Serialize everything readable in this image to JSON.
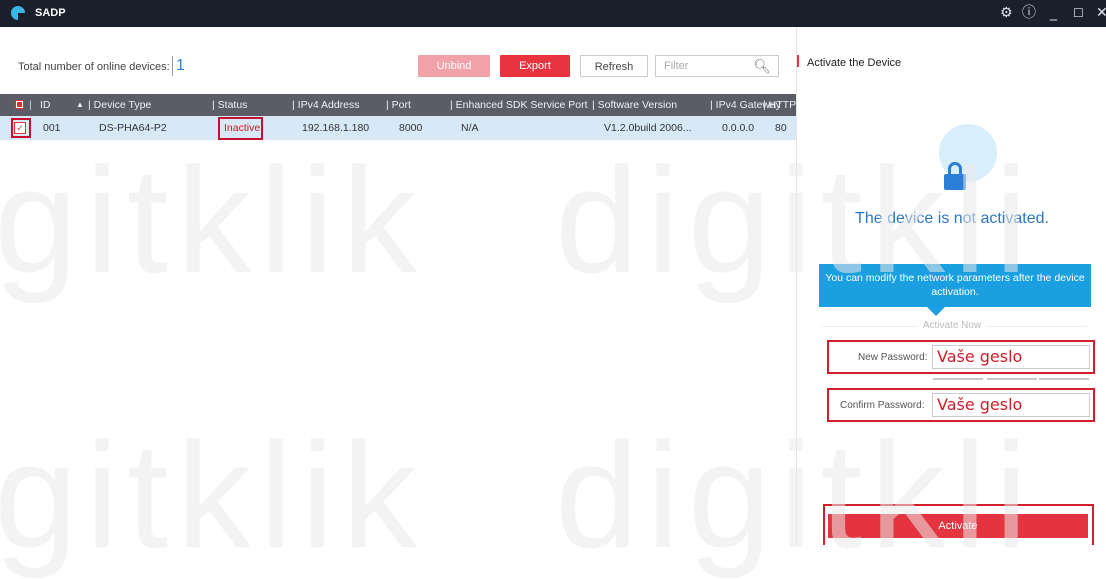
{
  "titlebar": {
    "app_name": "SADP",
    "icons": [
      "gear-icon",
      "info-icon",
      "minimize-icon",
      "maximize-icon",
      "close-icon"
    ]
  },
  "device_list": {
    "total_label": "Total number of online devices:",
    "total_count": "1",
    "buttons": {
      "unbind": "Unbind",
      "export": "Export",
      "refresh": "Refresh"
    },
    "filter_placeholder": "Filter",
    "columns": [
      "ID",
      "Device Type",
      "Status",
      "IPv4 Address",
      "Port",
      "Enhanced SDK Service Port",
      "Software Version",
      "IPv4 Gateway",
      "HTTP"
    ],
    "rows": [
      {
        "id": "001",
        "device_type": "DS-PHA64-P2",
        "status": "Inactive",
        "ipv4": "192.168.1.180",
        "port": "8000",
        "sdk_port": "N/A",
        "software_version": "V1.2.0build 2006...",
        "gateway": "0.0.0.0",
        "http": "80"
      }
    ]
  },
  "activate_panel": {
    "title": "Activate the Device",
    "status_message": "The device is not activated.",
    "tooltip": "You can modify the network parameters after the device activation.",
    "activate_now": "Activate Now",
    "new_password_label": "New Password:",
    "new_password_value": "Vaše geslo",
    "confirm_password_label": "Confirm Password:",
    "confirm_password_value": "Vaše geslo",
    "activate_button": "Activate"
  },
  "watermark": {
    "text_1": "gitklik",
    "text_2": "digitkli"
  },
  "colors": {
    "accent_red": "#e3343f",
    "titlebar": "#1a1f2b",
    "info_blue": "#1aa0e0"
  }
}
